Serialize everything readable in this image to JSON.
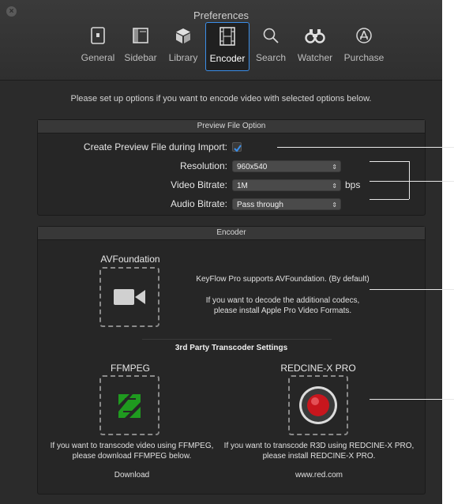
{
  "window": {
    "title": "Preferences"
  },
  "toolbar": [
    {
      "label": "General",
      "icon": "general-icon"
    },
    {
      "label": "Sidebar",
      "icon": "sidebar-icon"
    },
    {
      "label": "Library",
      "icon": "library-cube-icon"
    },
    {
      "label": "Encoder",
      "icon": "film-strip-icon",
      "active": true
    },
    {
      "label": "Search",
      "icon": "magnifier-icon"
    },
    {
      "label": "Watcher",
      "icon": "binoculars-icon"
    },
    {
      "label": "Purchase",
      "icon": "app-store-icon"
    }
  ],
  "intro": "Please set up options if you want to encode video with selected options below.",
  "preview": {
    "header": "Preview File Option",
    "create_label": "Create Preview File during Import:",
    "create_checked": true,
    "resolution_label": "Resolution:",
    "resolution_value": "960x540",
    "video_bitrate_label": "Video Bitrate:",
    "video_bitrate_value": "1M",
    "video_bitrate_unit": "bps",
    "audio_bitrate_label": "Audio Bitrate:",
    "audio_bitrate_value": "Pass through"
  },
  "encoder": {
    "header": "Encoder",
    "avf_title": "AVFoundation",
    "avf_line1": "KeyFlow Pro supports AVFoundation. (By default)",
    "avf_line2": "If you want to decode the additional codecs,",
    "avf_line3": "please install Apple Pro Video Formats.",
    "third_party_title": "3rd Party Transcoder Settings",
    "ffmpeg_title": "FFMPEG",
    "ffmpeg_line1": "If you want to transcode video using FFMPEG,",
    "ffmpeg_line2": "please download FFMPEG below.",
    "ffmpeg_link": "Download",
    "redcine_title": "REDCINE-X PRO",
    "redcine_line1": "If you want to transcode R3D using REDCINE-X PRO,",
    "redcine_line2": "please install REDCINE-X PRO.",
    "redcine_link": "www.red.com"
  },
  "colors": {
    "accent": "#3b8ee8",
    "ffmpeg_green": "#1f9a1f",
    "red_button": "#c8161d"
  }
}
